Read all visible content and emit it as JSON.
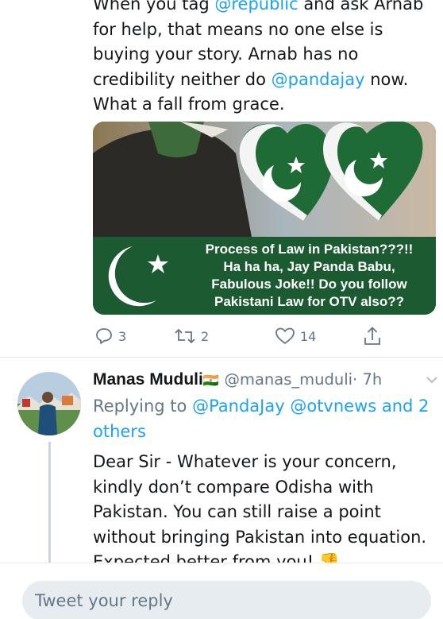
{
  "tweet1": {
    "text_parts": {
      "t1": "When you tag ",
      "m1": "@republic",
      "t2": " and ask Arnab for help, that means no one else is buying your story. Arnab has no credibility neither do ",
      "m2": "@pandajay",
      "t3": " now. What a fall from grace."
    },
    "media": {
      "banner_line1": "Process of Law in Pakistan???!!",
      "banner_line2": "Ha ha ha, Jay Panda Babu,",
      "banner_line3": "Fabulous Joke!! Do you follow",
      "banner_line4": "Pakistani Law for OTV also??"
    },
    "actions": {
      "replies": "3",
      "retweets": "2",
      "likes": "14"
    }
  },
  "tweet2": {
    "name": "Manas Muduli",
    "flag": "🇮🇳",
    "handle": "@manas_muduli",
    "time": "· 7h",
    "replying_label": "Replying to ",
    "replying_to": "@PandaJay @otvnews and 2 others",
    "text": "Dear Sir - Whatever is your concern, kindly don’t compare Odisha with Pakistan. You can still raise a point without bringing Pakistan into equation. Expected better from you!",
    "emoji": "👎"
  },
  "reply_box": {
    "placeholder": "Tweet your reply"
  },
  "colors": {
    "link": "#1da1f2",
    "muted": "#657786",
    "pakistan_green": "#1c5a31"
  }
}
